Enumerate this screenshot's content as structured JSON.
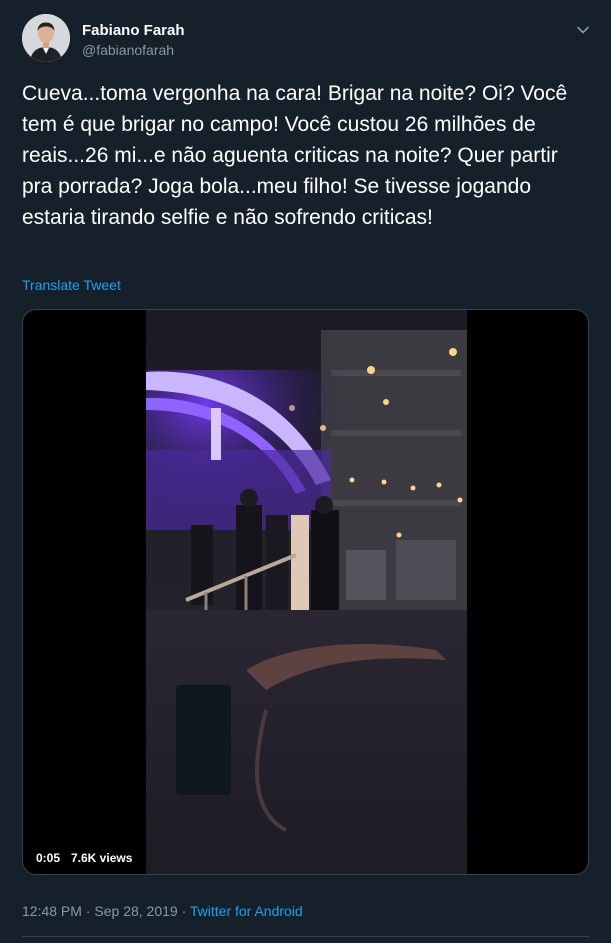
{
  "author": {
    "name": "Fabiano Farah",
    "handle": "@fabianofarah"
  },
  "tweet": {
    "text": "Cueva...toma vergonha na cara! Brigar na noite? Oi? Você tem é que brigar no campo! Você custou 26 milhões de reais...26 mi...e não aguenta criticas na noite? Quer partir pra porrada? Joga bola...meu filho! Se tivesse jogando estaria tirando selfie e não sofrendo criticas!",
    "translate_label": "Translate Tweet",
    "time": "12:48 PM",
    "separator": "·",
    "date": "Sep 28, 2019",
    "source": "Twitter for Android"
  },
  "video": {
    "elapsed": "0:05",
    "views": "7.6K views"
  },
  "icons": {
    "caret": "chevron-down-icon",
    "avatar": "avatar-photo"
  },
  "colors": {
    "background": "#15202b",
    "secondary_text": "#8899a6",
    "link": "#1da1f2",
    "divider": "#38444d"
  }
}
